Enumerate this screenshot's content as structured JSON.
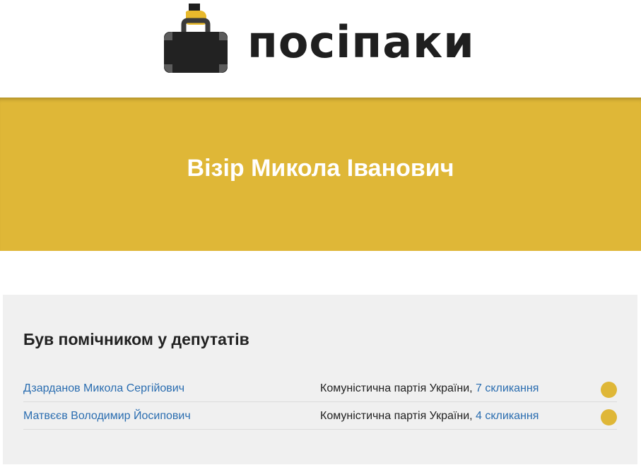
{
  "site": {
    "logo_text": "посіпаки"
  },
  "person": {
    "name": "Візір Микола Іванович"
  },
  "assistant_section": {
    "title": "Був помічником у депутатів",
    "rows": [
      {
        "deputy": "Дзарданов Микола Сергійович",
        "party": "Комуністична партія України,",
        "term": "7 скликання"
      },
      {
        "deputy": "Матвєєв Володимир Йосипович",
        "party": "Комуністична партія України,",
        "term": "4 скликання"
      }
    ]
  },
  "colors": {
    "accent": "#dfb737",
    "link": "#2a6db0",
    "text": "#222222",
    "section_bg": "#f0f0f0"
  }
}
